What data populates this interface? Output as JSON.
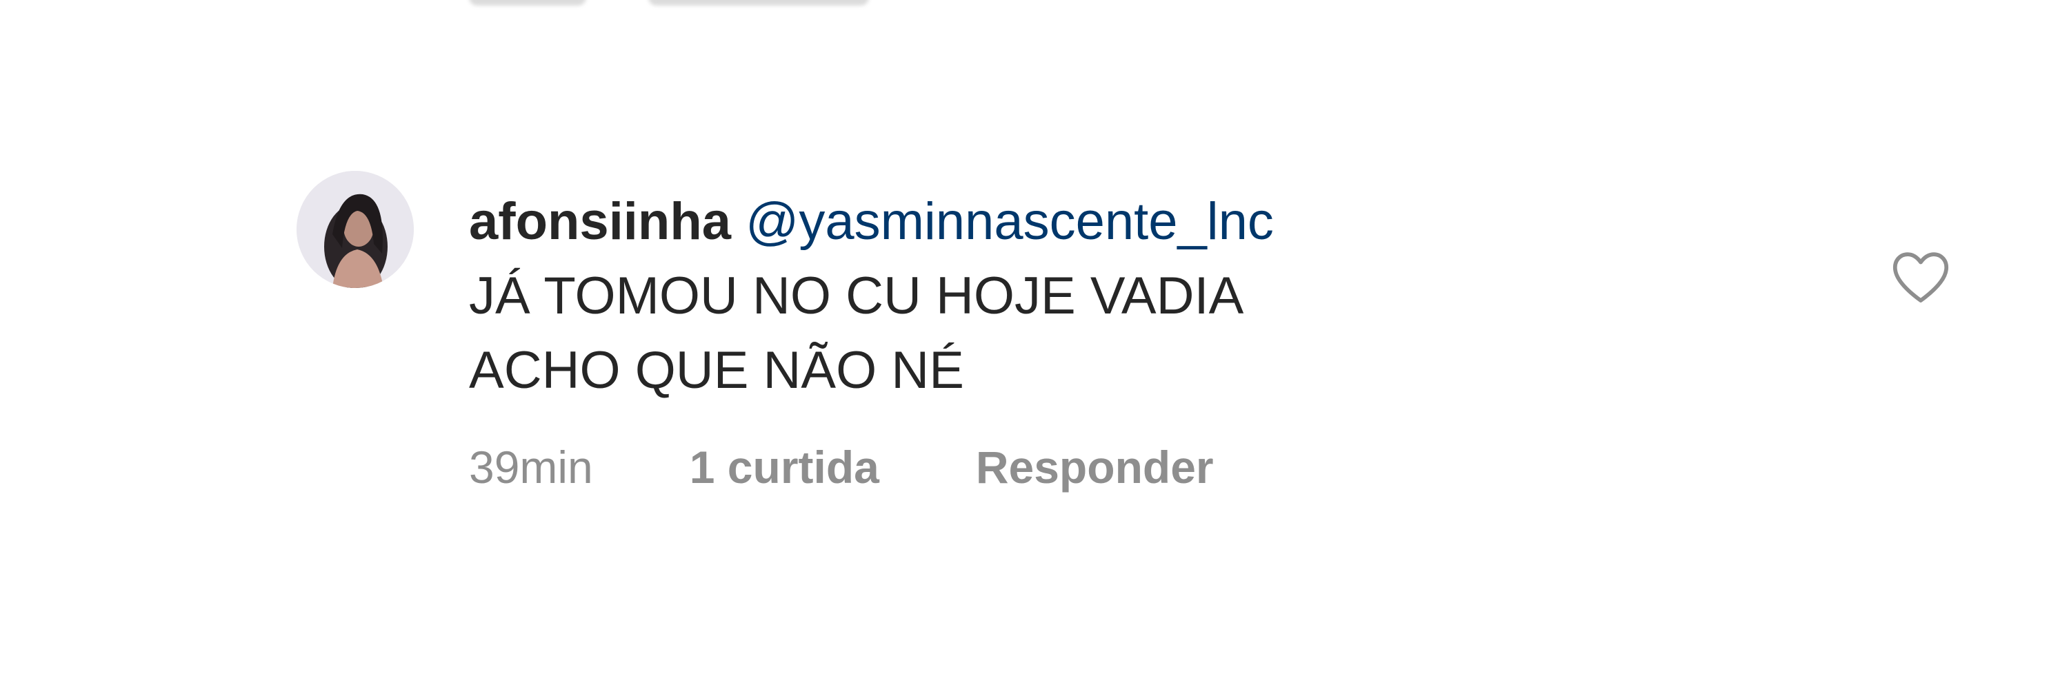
{
  "comment": {
    "username": "afonsiinha",
    "mention": "@yasminnascente_lnc",
    "text": "JÁ TOMOU NO CU HOJE VADIA\nACHO QUE NÃO NÉ",
    "time": "39min",
    "likes": "1 curtida",
    "reply_label": "Responder",
    "like_icon": "heart-outline-icon",
    "avatar_icon": "user-avatar"
  },
  "colors": {
    "text": "#262626",
    "mention": "#00376b",
    "meta": "#8e8e8e",
    "background": "#ffffff"
  }
}
